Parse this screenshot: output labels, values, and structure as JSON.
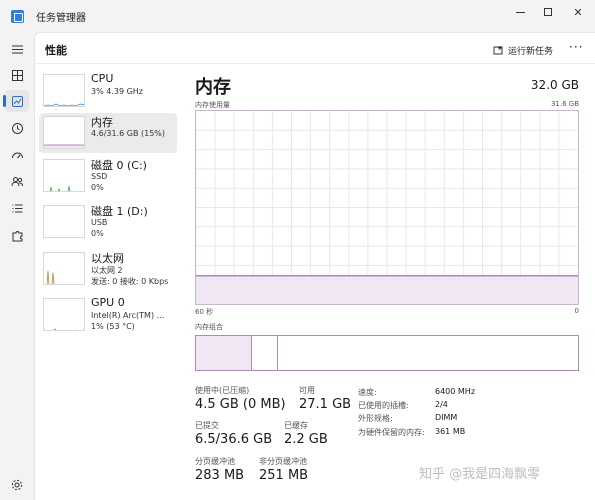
{
  "window": {
    "title": "任务管理器"
  },
  "header": {
    "page_title": "性能",
    "run_task_label": "运行新任务",
    "more_label": "···"
  },
  "devices": [
    {
      "name": "CPU",
      "line1": "3% 4.39 GHz",
      "line2": "",
      "line3": ""
    },
    {
      "name": "内存",
      "line1": "4.6/31.6 GB (15%)",
      "line2": "",
      "line3": ""
    },
    {
      "name": "磁盘 0 (C:)",
      "line1": "SSD",
      "line2": "0%",
      "line3": ""
    },
    {
      "name": "磁盘 1 (D:)",
      "line1": "USB",
      "line2": "0%",
      "line3": ""
    },
    {
      "name": "以太网",
      "line1": "以太网 2",
      "line2": "发送: 0 接收: 0 Kbps",
      "line3": ""
    },
    {
      "name": "GPU 0",
      "line1": "Intel(R) Arc(TM) ...",
      "line2": "1% (53 °C)",
      "line3": ""
    }
  ],
  "detail": {
    "title": "内存",
    "total": "32.0 GB",
    "graph_label": "内存使用量",
    "graph_max": "31.6 GB",
    "axis_left": "60 秒",
    "axis_right": "0",
    "composition_label": "内存组合",
    "usage_fraction": 0.146,
    "composition": {
      "in_use_fraction": 0.146,
      "modified_fraction": 0.068
    }
  },
  "stats": {
    "in_use_label": "使用中(已压缩)",
    "in_use_value": "4.5 GB (0 MB)",
    "available_label": "可用",
    "available_value": "27.1 GB",
    "committed_label": "已提交",
    "committed_value": "6.5/36.6 GB",
    "cached_label": "已缓存",
    "cached_value": "2.2 GB",
    "paged_label": "分页缓冲池",
    "paged_value": "283 MB",
    "nonpaged_label": "非分页缓冲池",
    "nonpaged_value": "251 MB"
  },
  "properties": [
    {
      "label": "速度:",
      "value": "6400 MHz"
    },
    {
      "label": "已使用的插槽:",
      "value": "2/4"
    },
    {
      "label": "外形规格:",
      "value": "DIMM"
    },
    {
      "label": "为硬件保留的内存:",
      "value": "361 MB"
    }
  ],
  "watermark": "知乎 @我是四海飘零",
  "colors": {
    "accent": "#2b6dc9",
    "memory_line": "#9b5fa6",
    "memory_fill": "#f1e6f3",
    "cpu_line": "#3b8fd6",
    "disk_line": "#4ca84c",
    "ethernet_line": "#b8863b",
    "gpu_line": "#3b8fd6"
  }
}
